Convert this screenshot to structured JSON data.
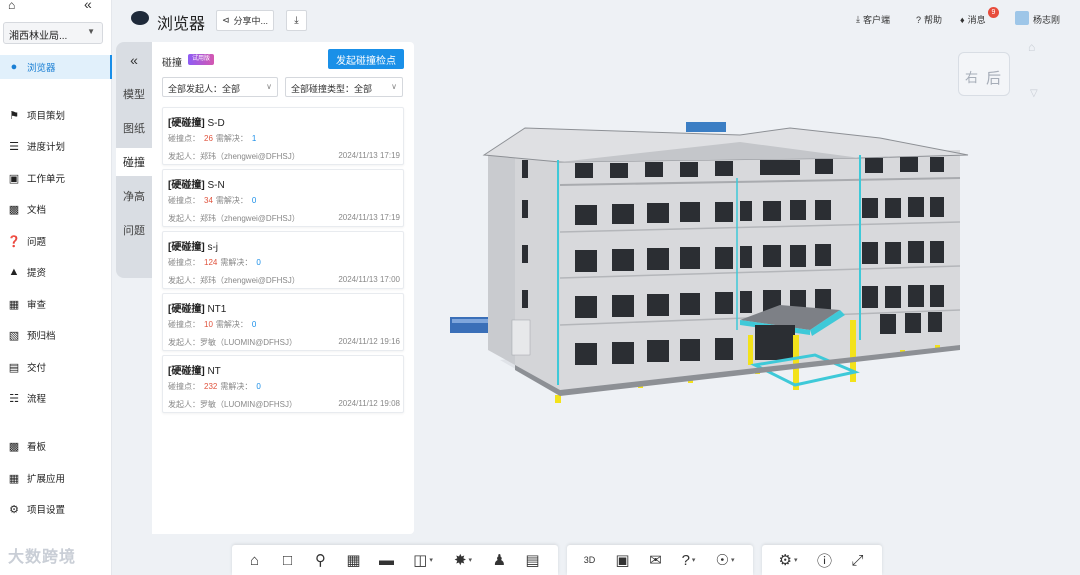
{
  "nav": {
    "project": "湘西林业局...",
    "items": [
      {
        "label": "浏览器",
        "icon": "browser-icon"
      },
      {
        "label": "项目策划",
        "icon": "flag-icon"
      },
      {
        "label": "进度计划",
        "icon": "gantt-icon"
      },
      {
        "label": "工作单元",
        "icon": "cube-icon"
      },
      {
        "label": "文档",
        "icon": "folder-icon"
      },
      {
        "label": "问题",
        "icon": "question-icon"
      },
      {
        "label": "提资",
        "icon": "upload-icon"
      },
      {
        "label": "审查",
        "icon": "review-icon"
      },
      {
        "label": "预归档",
        "icon": "archive-icon"
      },
      {
        "label": "交付",
        "icon": "delivery-icon"
      },
      {
        "label": "流程",
        "icon": "flow-icon"
      },
      {
        "label": "看板",
        "icon": "board-icon"
      },
      {
        "label": "扩展应用",
        "icon": "apps-icon"
      },
      {
        "label": "项目设置",
        "icon": "settings-icon"
      }
    ],
    "brand": "大数跨境"
  },
  "header": {
    "title": "浏览器",
    "share": "分享中...",
    "client": "客户端",
    "help": "帮助",
    "messages": "消息",
    "message_count": "9",
    "user": "杨志刚"
  },
  "side_tabs": [
    "模型",
    "图纸",
    "碰撞",
    "净高",
    "问题"
  ],
  "panel": {
    "title": "碰撞",
    "trial": "试用版",
    "start_button": "发起碰撞检点",
    "filter_initiator": "全部发起人：全部",
    "filter_type": "全部碰撞类型：全部",
    "stat_points_label": "碰撞点：",
    "stat_resolve_label": "需解决：",
    "initiator_label": "发起人：",
    "cards": [
      {
        "tag": "[硬碰撞]",
        "name": "S-D",
        "points": "26",
        "resolve": "1",
        "user": "郑玮（zhengwei@DFHSJ）",
        "date": "2024/11/13 17:19"
      },
      {
        "tag": "[硬碰撞]",
        "name": "S-N",
        "points": "34",
        "resolve": "0",
        "user": "郑玮（zhengwei@DFHSJ）",
        "date": "2024/11/13 17:19"
      },
      {
        "tag": "[硬碰撞]",
        "name": "s-j",
        "points": "124",
        "resolve": "0",
        "user": "郑玮（zhengwei@DFHSJ）",
        "date": "2024/11/13 17:00"
      },
      {
        "tag": "[硬碰撞]",
        "name": "NT1",
        "points": "10",
        "resolve": "0",
        "user": "罗敏（LUOMIN@DFHSJ）",
        "date": "2024/11/12 19:16"
      },
      {
        "tag": "[硬碰撞]",
        "name": "NT",
        "points": "232",
        "resolve": "0",
        "user": "罗敏（LUOMIN@DFHSJ）",
        "date": "2024/11/12 19:08"
      }
    ]
  },
  "viewcube": {
    "face_left": "右",
    "face_right": "后"
  }
}
